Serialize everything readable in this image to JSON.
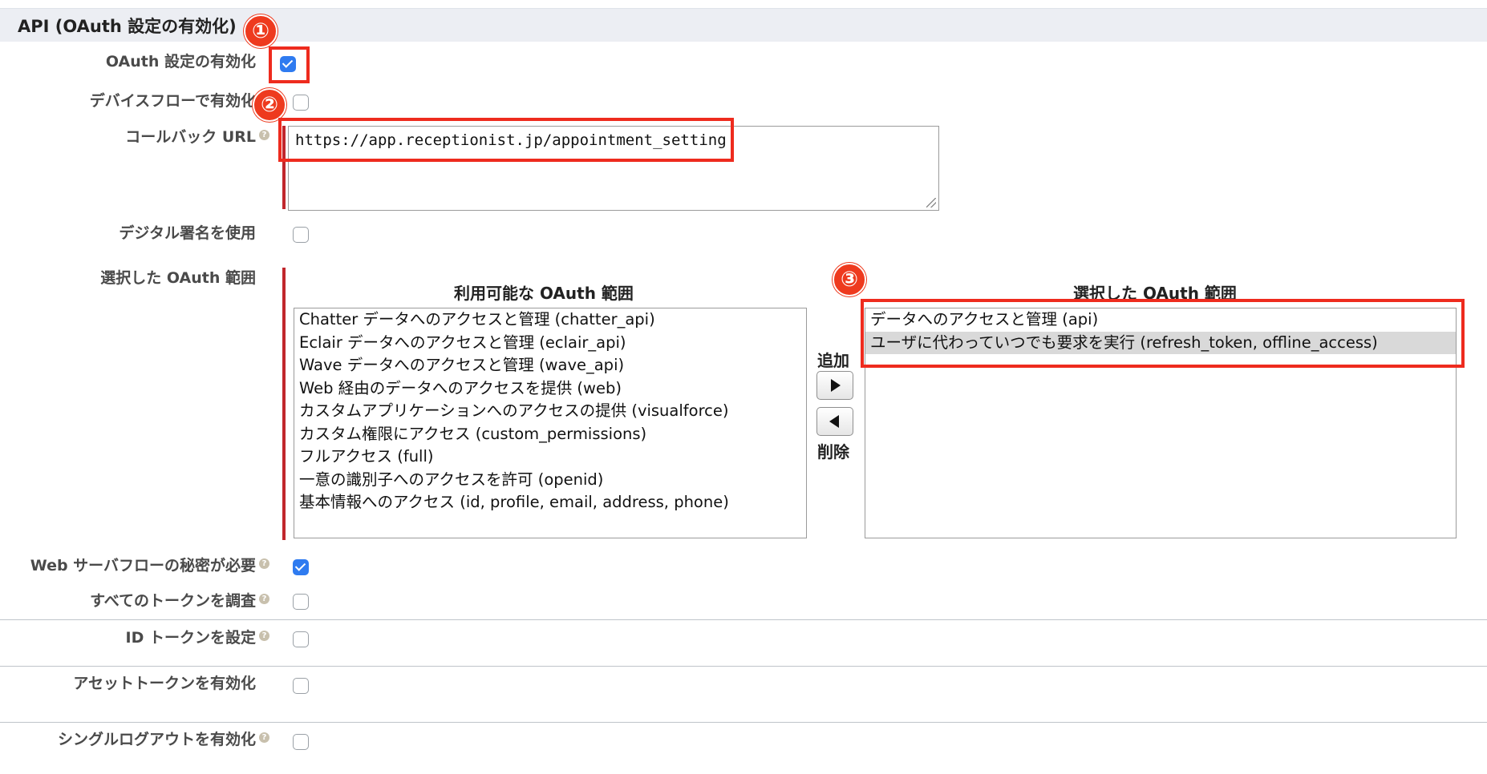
{
  "section": {
    "title": "API (OAuth 設定の有効化)"
  },
  "fields": {
    "enable_oauth": {
      "label": "OAuth 設定の有効化",
      "checked": true
    },
    "device_flow": {
      "label": "デバイスフローで有効化",
      "checked": false
    },
    "callback_url": {
      "label": "コールバック URL",
      "value": "https://app.receptionist.jp/appointment_setting"
    },
    "digital_signature": {
      "label": "デジタル署名を使用",
      "checked": false
    },
    "oauth_scopes": {
      "label": "選択した OAuth 範囲"
    },
    "web_server_secret": {
      "label": "Web サーバフローの秘密が必要",
      "checked": true
    },
    "introspect_tokens": {
      "label": "すべてのトークンを調査",
      "checked": false
    },
    "id_token": {
      "label": "ID トークンを設定",
      "checked": false
    },
    "asset_tokens": {
      "label": "アセットトークンを有効化",
      "checked": false
    },
    "single_logout": {
      "label": "シングルログアウトを有効化",
      "checked": false
    }
  },
  "scopes": {
    "available_title": "利用可能な OAuth 範囲",
    "selected_title": "選択した OAuth 範囲",
    "available": [
      "Chatter データへのアクセスと管理 (chatter_api)",
      "Eclair データへのアクセスと管理 (eclair_api)",
      "Wave データへのアクセスと管理 (wave_api)",
      "Web 経由のデータへのアクセスを提供 (web)",
      "カスタムアプリケーションへのアクセスの提供 (visualforce)",
      "カスタム権限にアクセス (custom_permissions)",
      "フルアクセス (full)",
      "一意の識別子へのアクセスを許可 (openid)",
      "基本情報へのアクセス (id, profile, email, address, phone)"
    ],
    "selected": [
      "データへのアクセスと管理 (api)",
      "ユーザに代わっていつでも要求を実行 (refresh_token, offline_access)"
    ],
    "add_label": "追加",
    "remove_label": "削除"
  },
  "annotations": {
    "step1": "①",
    "step2": "②",
    "step3": "③"
  },
  "icons": {
    "help": "help-icon",
    "add": "arrow-right-icon",
    "remove": "arrow-left-icon"
  },
  "colors": {
    "accent": "#2f7bf0",
    "annotation": "#ee2b1e",
    "required": "#c1272d",
    "header_bg": "#eceef3"
  }
}
